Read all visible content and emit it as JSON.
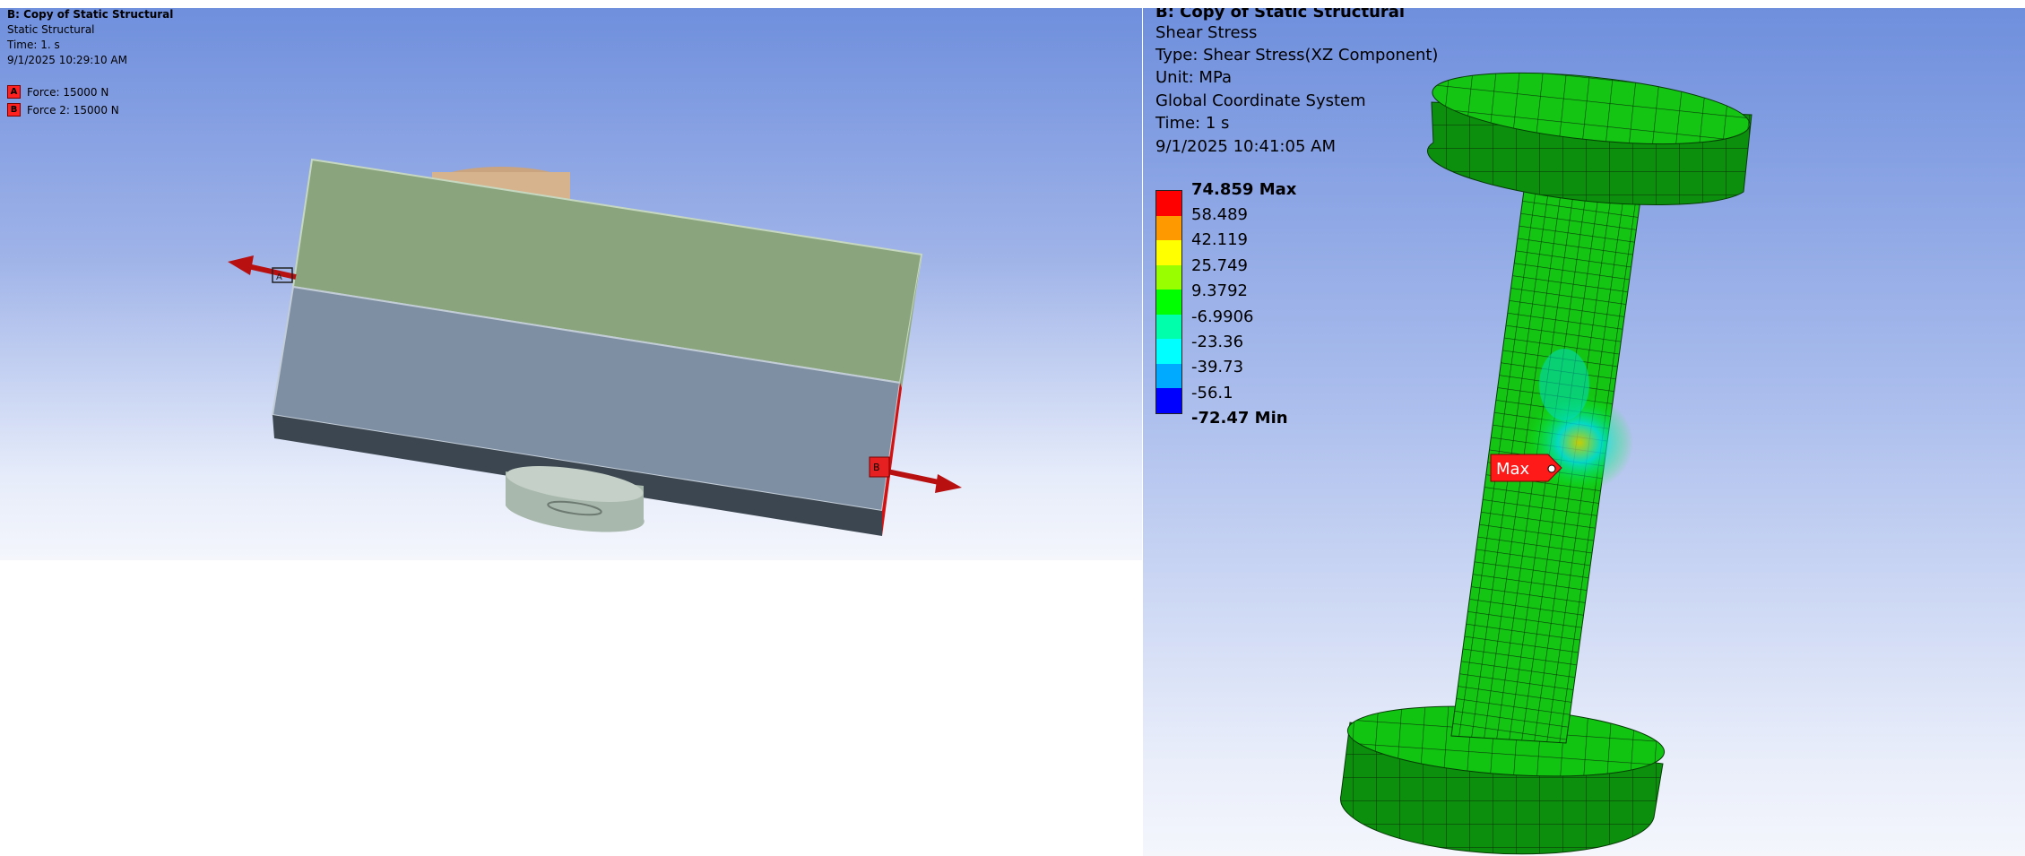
{
  "left_view": {
    "title": "B: Copy of Static Structural",
    "subtitle": "Static Structural",
    "time": "Time: 1. s",
    "date": "9/1/2025 10:29:10 AM",
    "loads": [
      {
        "tag": "A",
        "label": "Force: 15000 N",
        "color": "#ff2020"
      },
      {
        "tag": "B",
        "label": "Force 2: 15000 N",
        "color": "#ff2020"
      }
    ],
    "arrow_a_label": "A",
    "arrow_b_label": "B"
  },
  "right_view": {
    "title": "B: Copy of Static Structural",
    "result_name": "Shear Stress",
    "type": "Type: Shear Stress(XZ Component)",
    "unit": "Unit: MPa",
    "coordinate_system": "Global Coordinate System",
    "time": "Time: 1 s",
    "date": "9/1/2025 10:41:05 AM",
    "legend": {
      "max_label": "74.859 Max",
      "min_label": "-72.47 Min",
      "values": [
        "58.489",
        "42.119",
        "25.749",
        "9.3792",
        "-6.9906",
        "-23.36",
        "-39.73",
        "-56.1"
      ],
      "colors": [
        "#ff0000",
        "#ff9900",
        "#ffff00",
        "#99ff00",
        "#00ff00",
        "#00ffaa",
        "#00ffff",
        "#00aaff",
        "#0000ff"
      ]
    },
    "probe_label": "Max"
  }
}
